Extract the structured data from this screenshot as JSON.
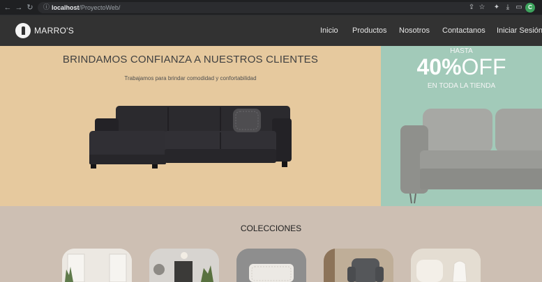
{
  "browser": {
    "url_host": "localhost",
    "url_path": "/ProyectoWeb/",
    "profile_initial": "C",
    "accent": "#3da35d"
  },
  "header": {
    "brand": "MARRO'S",
    "nav": [
      "Inicio",
      "Productos",
      "Nosotros",
      "Contactanos",
      "Iniciar Sesión"
    ]
  },
  "hero": {
    "title": "BRINDAMOS CONFIANZA A NUESTROS CLIENTES",
    "subtitle": "Trabajamos para brindar comodidad y confortabilidad",
    "background": "#e6c99e"
  },
  "promo": {
    "top": "HASTA",
    "percent": "40%",
    "off": "OFF",
    "bottom": "EN TODA LA TIENDA",
    "background": "#a2cab9"
  },
  "collections": {
    "title": "COLECCIONES",
    "background": "#cdbfb3"
  },
  "icons": [
    "back-icon",
    "forward-icon",
    "reload-icon",
    "info-icon",
    "share-icon",
    "star-icon",
    "extensions-icon",
    "download-icon",
    "sidepanel-icon"
  ]
}
